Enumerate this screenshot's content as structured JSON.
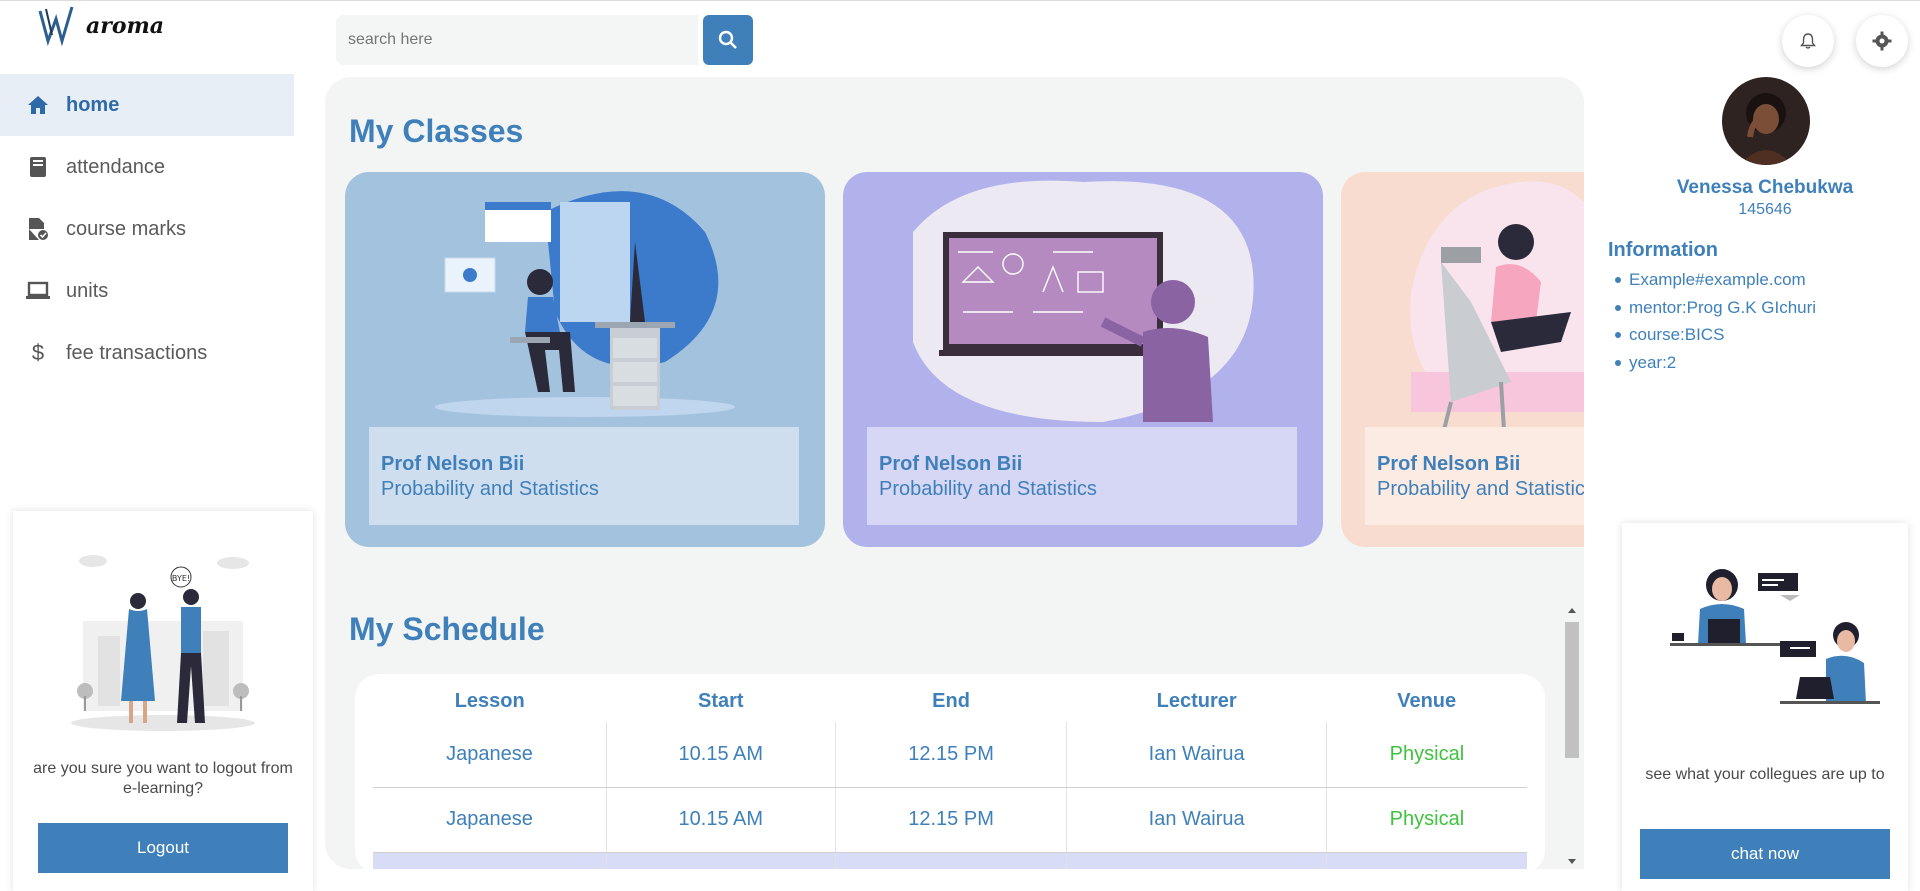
{
  "app": {
    "logo_text": "aroma"
  },
  "search": {
    "placeholder": "search here"
  },
  "sidebar": {
    "items": [
      {
        "label": "home",
        "icon": "home-icon",
        "active": true
      },
      {
        "label": "attendance",
        "icon": "book-icon",
        "active": false
      },
      {
        "label": "course marks",
        "icon": "file-check-icon",
        "active": false
      },
      {
        "label": "units",
        "icon": "laptop-icon",
        "active": false
      },
      {
        "label": "fee transactions",
        "icon": "dollar-icon",
        "active": false
      }
    ]
  },
  "logout_card": {
    "message": "are you sure you want to logout from e-learning?",
    "button_label": "Logout",
    "bubble_text": "BYE!"
  },
  "main": {
    "classes_title": "My Classes",
    "classes": [
      {
        "professor": "Prof Nelson Bii",
        "course": "Probability and Statistics",
        "color": "#a3c2de"
      },
      {
        "professor": "Prof Nelson Bii",
        "course": "Probability and Statistics",
        "color": "#b1b1ec"
      },
      {
        "professor": "Prof Nelson Bii",
        "course": "Probability and Statistics",
        "color": "#f7dccf"
      }
    ],
    "schedule_title": "My Schedule",
    "schedule_headers": [
      "Lesson",
      "Start",
      "End",
      "Lecturer",
      "Venue"
    ],
    "schedule_rows": [
      {
        "lesson": "Japanese",
        "start": "10.15 AM",
        "end": "12.15 PM",
        "lecturer": "Ian Wairua",
        "venue": "Physical"
      },
      {
        "lesson": "Japanese",
        "start": "10.15 AM",
        "end": "12.15 PM",
        "lecturer": "Ian Wairua",
        "venue": "Physical"
      }
    ]
  },
  "profile": {
    "name": "Venessa Chebukwa",
    "id": "145646",
    "info_title": "Information",
    "info": [
      "Example#example.com",
      "mentor:Prog G.K GIchuri",
      "course:BICS",
      "year:2"
    ]
  },
  "chat_card": {
    "message": "see what your collegues are up to",
    "button_label": "chat now"
  },
  "colors": {
    "accent": "#3f80ba",
    "venue": "#3ec33e",
    "panel_bg": "#f3f4f4"
  }
}
